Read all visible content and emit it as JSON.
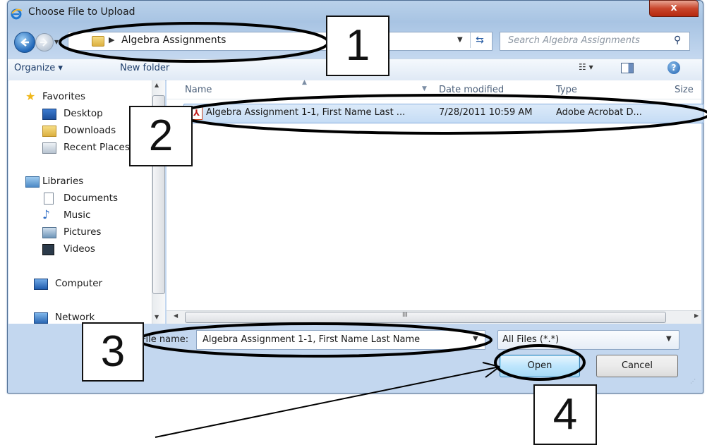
{
  "window": {
    "title": "Choose File to Upload",
    "close_glyph": "x"
  },
  "navigation": {
    "back_icon": "back-arrow-icon",
    "forward_icon": "forward-arrow-icon",
    "address_path": "Algebra Assignments",
    "search_placeholder": "Search Algebra Assignments"
  },
  "toolbar": {
    "organize_label": "Organize ▾",
    "new_folder_label": "New folder",
    "views_label": "☷ ▾",
    "help_glyph": "?"
  },
  "sidebar": {
    "items": [
      {
        "label": "Favorites",
        "icon": "star-icon"
      },
      {
        "label": "Desktop",
        "icon": "desktop-icon"
      },
      {
        "label": "Downloads",
        "icon": "downloads-icon"
      },
      {
        "label": "Recent Places",
        "icon": "recent-places-icon"
      },
      {
        "label": "Libraries",
        "icon": "libraries-icon"
      },
      {
        "label": "Documents",
        "icon": "documents-icon"
      },
      {
        "label": "Music",
        "icon": "music-icon"
      },
      {
        "label": "Pictures",
        "icon": "pictures-icon"
      },
      {
        "label": "Videos",
        "icon": "videos-icon"
      },
      {
        "label": "Computer",
        "icon": "computer-icon"
      },
      {
        "label": "Network",
        "icon": "network-icon"
      }
    ]
  },
  "file_list": {
    "columns": [
      "Name",
      "Date modified",
      "Type",
      "Size"
    ],
    "rows": [
      {
        "name": "Algebra Assignment 1-1, First Name Last ...",
        "date_modified": "7/28/2011 10:59 AM",
        "type": "Adobe Acrobat D..."
      }
    ],
    "hscroll_grip": "III"
  },
  "bottom_bar": {
    "file_name_label": "File name:",
    "file_name_value": "Algebra Assignment 1-1, First Name Last Name",
    "filter_value": "All Files (*.*)",
    "open_label": "Open",
    "cancel_label": "Cancel"
  },
  "annotations": {
    "labels": [
      "1",
      "2",
      "3",
      "4"
    ],
    "stroke_color": "#000000"
  },
  "colors": {
    "frame": "#c3d7ef",
    "selection": "#c5dcf5",
    "close_button": "#c9462c",
    "open_button": "#bee6fd"
  }
}
